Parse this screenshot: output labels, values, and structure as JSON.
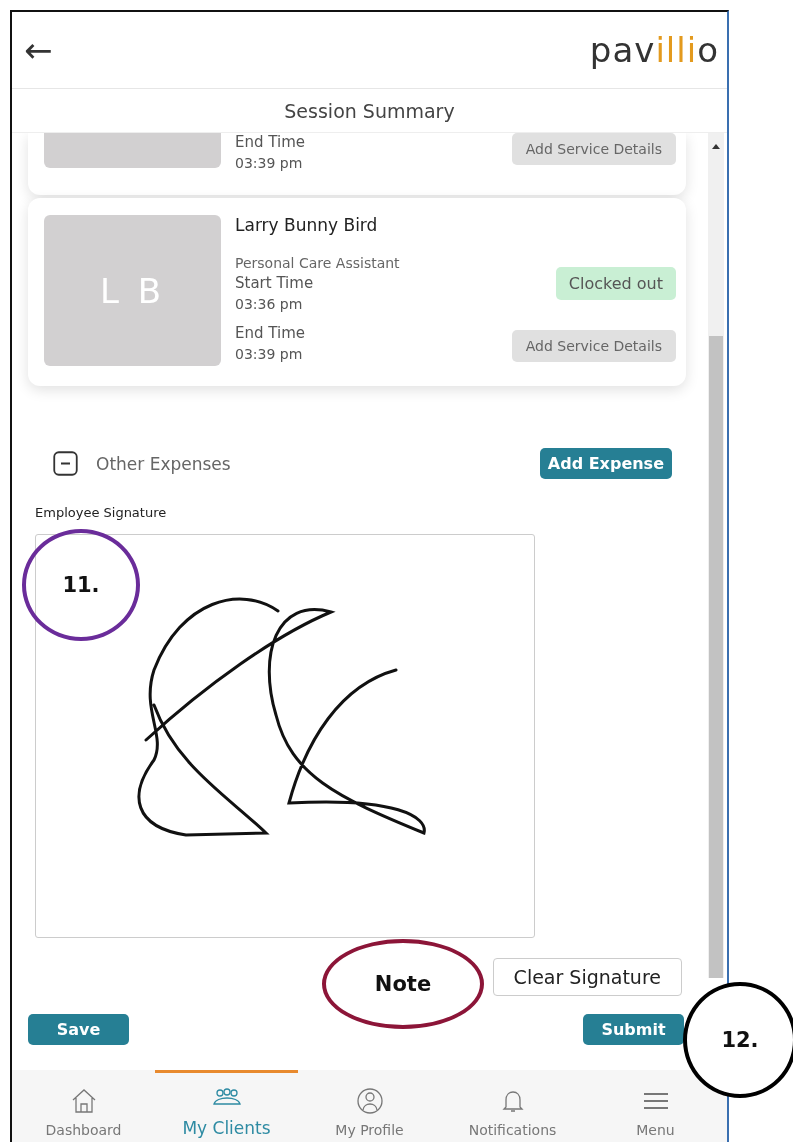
{
  "header": {
    "back_icon": "←",
    "logo": {
      "prefix": "pav",
      "accent": "illi",
      "suffix": "o"
    }
  },
  "title": "Session Summary",
  "sessions": [
    {
      "cut_off": true,
      "end_label": "End Time",
      "end_time": "03:39 pm",
      "button": "Add Service Details"
    },
    {
      "cut_off": false,
      "initials": "L B",
      "name": "Larry Bunny Bird",
      "role": "Personal Care Assistant",
      "start_label": "Start Time",
      "start_time": "03:36 pm",
      "end_label": "End Time",
      "end_time": "03:39 pm",
      "status": "Clocked out",
      "button": "Add Service Details"
    }
  ],
  "expenses": {
    "expanded": true,
    "label": "Other Expenses",
    "button": "Add Expense"
  },
  "signature": {
    "label": "Employee Signature",
    "signed": true,
    "clear_button": "Clear Signature"
  },
  "actions": {
    "save": "Save",
    "submit": "Submit"
  },
  "nav": [
    {
      "label": "Dashboard",
      "selected": false
    },
    {
      "label": "My Clients",
      "selected": true
    },
    {
      "label": "My Profile",
      "selected": false
    },
    {
      "label": "Notifications",
      "selected": false
    },
    {
      "label": "Menu",
      "selected": false
    }
  ],
  "annotations": [
    {
      "text": "11.",
      "kind": "circle",
      "color": "#6a2c9a"
    },
    {
      "text": "Note",
      "kind": "oval",
      "color": "#8c1538"
    },
    {
      "text": "12.",
      "kind": "circle",
      "color": "#000000"
    }
  ]
}
